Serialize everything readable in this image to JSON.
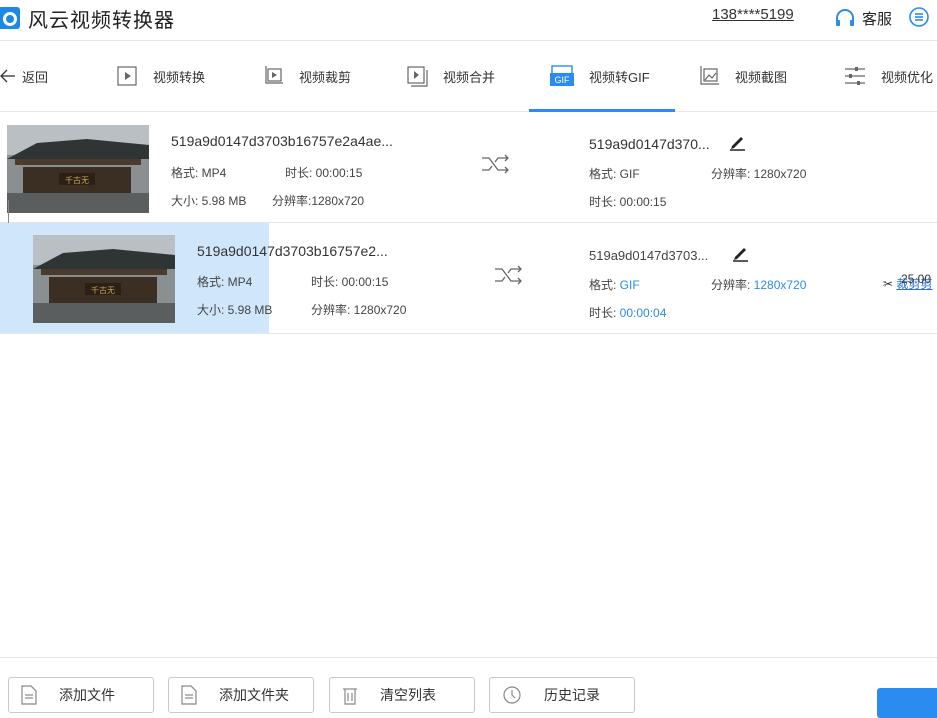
{
  "app": {
    "title": "风云视频转换器",
    "phone": "138****5199",
    "support": "客服"
  },
  "nav": {
    "back": "返回",
    "tabs": [
      "视频转换",
      "视频裁剪",
      "视频合并",
      "视频转GIF",
      "视频截图",
      "视频优化"
    ],
    "active_index": 3
  },
  "rows": [
    {
      "source": {
        "name": "519a9d0147d3703b16757e2a4ae...",
        "format": "格式: MP4",
        "duration": "时长: 00:00:15",
        "size": "大小: 5.98 MB",
        "resolution": "分辨率:1280x720"
      },
      "output": {
        "name": "519a9d0147d370...",
        "format": "格式: GIF",
        "resolution_label": "分辨率: ",
        "resolution": "1280x720",
        "duration_label": "时长: ",
        "duration": "00:00:15"
      },
      "action": "裁剪剪"
    },
    {
      "source": {
        "name": "519a9d0147d3703b16757e2...",
        "format": "格式: MP4",
        "duration": "时长: 00:00:15",
        "size": "大小: 5.98 MB",
        "resolution": "分辨率: 1280x720"
      },
      "output": {
        "name": "519a9d0147d3703...",
        "format_label": "格式: ",
        "format": "GIF",
        "resolution_label": "分辨率: ",
        "resolution": "1280x720",
        "duration_label": "时长: ",
        "duration": "00:00:04"
      },
      "extra": "25.00"
    }
  ],
  "footer": {
    "buttons": [
      "添加文件",
      "添加文件夹",
      "清空列表",
      "历史记录"
    ]
  },
  "colors": {
    "accent": "#2a8cf0",
    "selected_bg": "#cfe6fb"
  }
}
